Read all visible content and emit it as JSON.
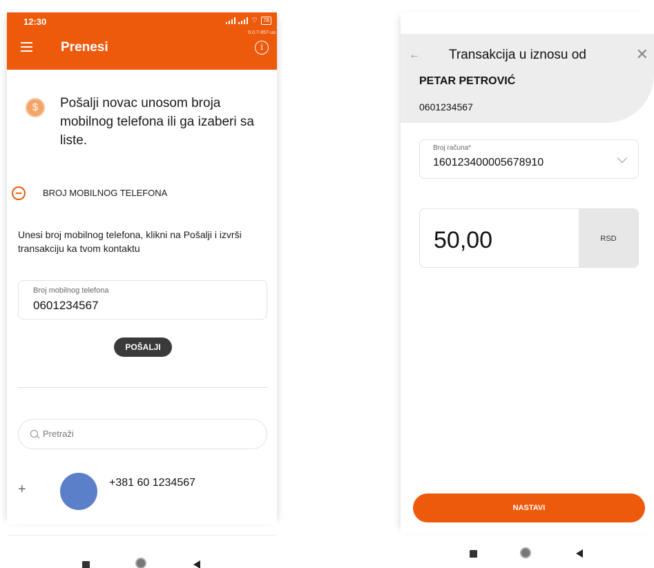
{
  "left_screen": {
    "status_bar": {
      "time": "12:30",
      "battery": "78",
      "version": "6.0.7-857-ua"
    },
    "appbar": {
      "title": "Prenesi"
    },
    "intro_text": "Pošalji novac unosom broja mobilnog telefona ili ga izaberi sa liste.",
    "section_label": "BROJ MOBILNOG TELEFONA",
    "description": "Unesi broj mobilnog telefona, klikni na Pošalji i izvrši transakciju ka tvom kontaktu",
    "phone_field": {
      "label": "Broj mobilnog telefona",
      "value": "0601234567"
    },
    "send_label": "POŠALJI",
    "search": {
      "placeholder": "Pretraži"
    },
    "contact": {
      "number": "+381 60 1234567"
    }
  },
  "right_screen": {
    "header_title": "Transakcija u iznosu od",
    "recipient_name": "PETAR PETROVIĆ",
    "recipient_number": "0601234567",
    "account": {
      "label": "Broj računa*",
      "value": "160123400005678910"
    },
    "amount": {
      "value": "50,00",
      "currency": "RSD"
    },
    "continue_label": "NASTAVI"
  },
  "icons": [
    "menu-icon",
    "info-icon",
    "coin-icon",
    "collapse-icon",
    "search-icon",
    "plus-icon",
    "back-arrow-icon",
    "close-icon",
    "chevron-down-icon"
  ],
  "colors": {
    "accent": "#ee5a0c",
    "dark_button": "#3a3a3a",
    "avatar": "#5b7fc9",
    "panel": "#ededed"
  }
}
